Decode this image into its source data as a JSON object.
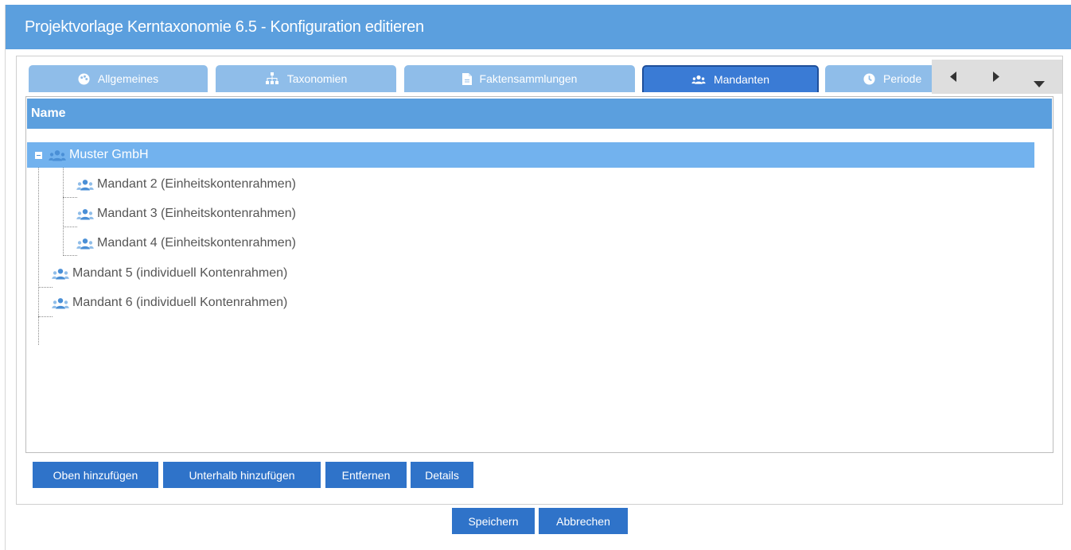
{
  "window": {
    "title": "Projektvorlage Kerntaxonomie 6.5 - Konfiguration editieren"
  },
  "tabs": [
    {
      "label": "Allgemeines",
      "icon": "palette-icon",
      "active": false
    },
    {
      "label": "Taxonomien",
      "icon": "hierarchy-icon",
      "active": false
    },
    {
      "label": "Faktensammlungen",
      "icon": "document-icon",
      "active": false
    },
    {
      "label": "Mandanten",
      "icon": "users-icon",
      "active": true
    },
    {
      "label": "Periode",
      "icon": "clock-icon",
      "active": false
    }
  ],
  "tab_scroller": {
    "left_icon": "arrow-left-icon",
    "right_icon": "arrow-right-icon",
    "menu_icon": "dropdown-icon"
  },
  "tree": {
    "column_header": "Name",
    "nodes": [
      {
        "label": "Muster GmbH",
        "level": 0,
        "selected": true,
        "expanded": true
      },
      {
        "label": "Mandant 2 (Einheitskontenrahmen)",
        "level": 1
      },
      {
        "label": "Mandant 3 (Einheitskontenrahmen)",
        "level": 1
      },
      {
        "label": "Mandant 4 (Einheitskontenrahmen)",
        "level": 1
      },
      {
        "label": "Mandant 5 (individuell Kontenrahmen)",
        "level": 0
      },
      {
        "label": "Mandant 6 (individuell Kontenrahmen)",
        "level": 0
      }
    ]
  },
  "actions": {
    "add_above": "Oben hinzufügen",
    "add_below": "Unterhalb hinzufügen",
    "remove": "Entfernen",
    "details": "Details"
  },
  "footer": {
    "save": "Speichern",
    "cancel": "Abbrechen"
  },
  "colors": {
    "titlebar": "#5b9fde",
    "tab_inactive": "#8fbde9",
    "tab_active": "#3a7bd5",
    "selected_row": "#72b2ee",
    "button": "#2f73c9"
  }
}
